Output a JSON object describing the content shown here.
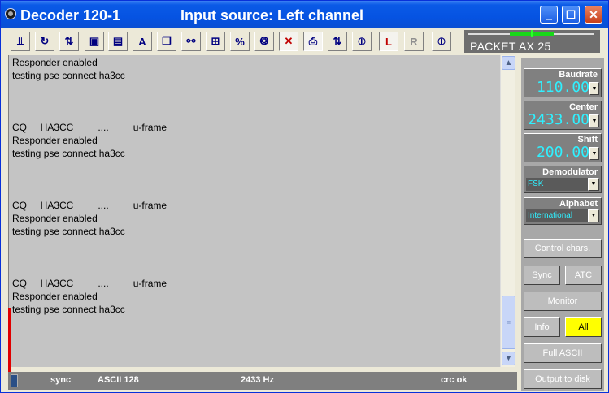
{
  "window": {
    "app_title": "Decoder 120-1",
    "input_source": "Input source: Left channel",
    "min_glyph": "_",
    "max_glyph": "☐",
    "close_glyph": "✕"
  },
  "toolbar": {
    "tools": [
      {
        "name": "tool-scope-icon",
        "glyph": "⫫"
      },
      {
        "name": "tool-refresh-icon",
        "glyph": "↻"
      },
      {
        "name": "tool-swap-icon",
        "glyph": "⇅"
      },
      {
        "name": "tool-save-jpg-icon",
        "glyph": "▣"
      },
      {
        "name": "tool-save-txt-icon",
        "glyph": "▤"
      },
      {
        "name": "tool-font-icon",
        "glyph": "A"
      },
      {
        "name": "tool-copy-icon",
        "glyph": "❐"
      },
      {
        "name": "tool-binoculars-icon",
        "glyph": "⚯"
      },
      {
        "name": "tool-tag-icon",
        "glyph": "⊞"
      },
      {
        "name": "tool-filter-icon",
        "glyph": "%"
      },
      {
        "name": "tool-antenna-icon",
        "glyph": "❂"
      },
      {
        "name": "tool-crosstalk-icon",
        "glyph": "✕"
      },
      {
        "name": "tool-printer-icon",
        "glyph": "⎙"
      },
      {
        "name": "tool-updown-icon",
        "glyph": "⇅"
      },
      {
        "name": "tool-phase-icon",
        "glyph": "⦶"
      },
      {
        "name": "tool-left-channel-icon",
        "glyph": "L"
      },
      {
        "name": "tool-right-channel-icon",
        "glyph": "R"
      },
      {
        "name": "tool-phase2-icon",
        "glyph": "⦶"
      }
    ]
  },
  "tuner": {
    "label": "PACKET AX 25"
  },
  "output": {
    "lines": [
      "Responder enabled",
      "testing pse connect ha3cc",
      "",
      "",
      "",
      "CQ     HA3CC         ....         u-frame",
      "Responder enabled",
      "testing pse connect ha3cc",
      "",
      "",
      "",
      "CQ     HA3CC         ....         u-frame",
      "Responder enabled",
      "testing pse connect ha3cc",
      "",
      "",
      "",
      "CQ     HA3CC         ....         u-frame",
      "Responder enabled",
      "testing pse connect ha3cc"
    ]
  },
  "status": {
    "sync": "sync",
    "mode": "ASCII 128",
    "freq": "2433 Hz",
    "crc": "crc ok"
  },
  "panel": {
    "baudrate": {
      "title": "Baudrate",
      "value": "110.00"
    },
    "center": {
      "title": "Center",
      "value": "2433.00"
    },
    "shift": {
      "title": "Shift",
      "value": "200.00"
    },
    "demodulator": {
      "title": "Demodulator",
      "value": "FSK"
    },
    "alphabet": {
      "title": "Alphabet",
      "value": "International"
    },
    "buttons": {
      "control_chars": "Control chars.",
      "sync": "Sync",
      "atc": "ATC",
      "monitor": "Monitor",
      "info": "Info",
      "all": "All",
      "full_ascii": "Full ASCII",
      "output_to_disk": "Output to disk"
    },
    "dropdown_glyph": "▼",
    "scroll_up": "▲",
    "scroll_down": "▼",
    "scroll_grip": "≡"
  },
  "colors": {
    "titlebar": "#0653e2",
    "digital_text": "#2ff0ff",
    "active_button": "#ffff00",
    "text_area": "#c4c4c4"
  }
}
